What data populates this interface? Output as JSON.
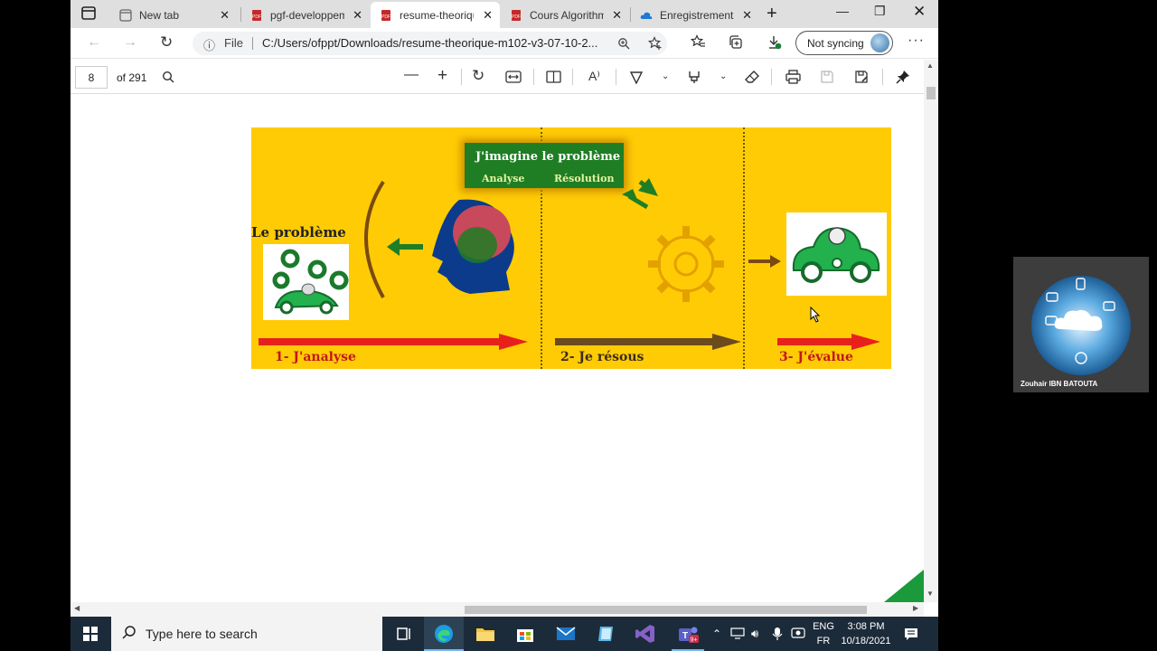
{
  "browser": {
    "tabs": [
      {
        "label": "New tab",
        "icon": "new-tab-page-icon",
        "active": false
      },
      {
        "label": "pgf-developpem",
        "icon": "pdf-icon",
        "active": false
      },
      {
        "label": "resume-theoriqu",
        "icon": "pdf-icon",
        "active": true
      },
      {
        "label": "Cours Algorithm",
        "icon": "pdf-icon",
        "active": false
      },
      {
        "label": "Enregistrements",
        "icon": "onedrive-cloud-icon",
        "active": false
      }
    ],
    "address": {
      "info_label": "ⓘ",
      "scheme_label": "File",
      "url": "C:/Users/ofppt/Downloads/resume-theorique-m102-v3-07-10-2..."
    },
    "sync_label": "Not syncing"
  },
  "pdf": {
    "page_current": "8",
    "page_total_label": "of 291"
  },
  "figure": {
    "header_title": "J'imagine le problème",
    "header_left": "Analyse",
    "header_right": "Résolution",
    "problem_label": "Le problème",
    "step1": "1- J'analyse",
    "step2": "2- Je résous",
    "step3": "3- J'évalue",
    "colors": {
      "background": "#ffcb05",
      "red_arrow": "#e8201c",
      "brown_arrow": "#6b4a1e",
      "car_green": "#22b14c"
    }
  },
  "camera": {
    "name": "Zouhair IBN BATOUTA"
  },
  "taskbar": {
    "search_placeholder": "Type here to search",
    "lang_top": "ENG",
    "lang_bottom": "FR",
    "time": "3:08 PM",
    "date": "10/18/2021"
  }
}
